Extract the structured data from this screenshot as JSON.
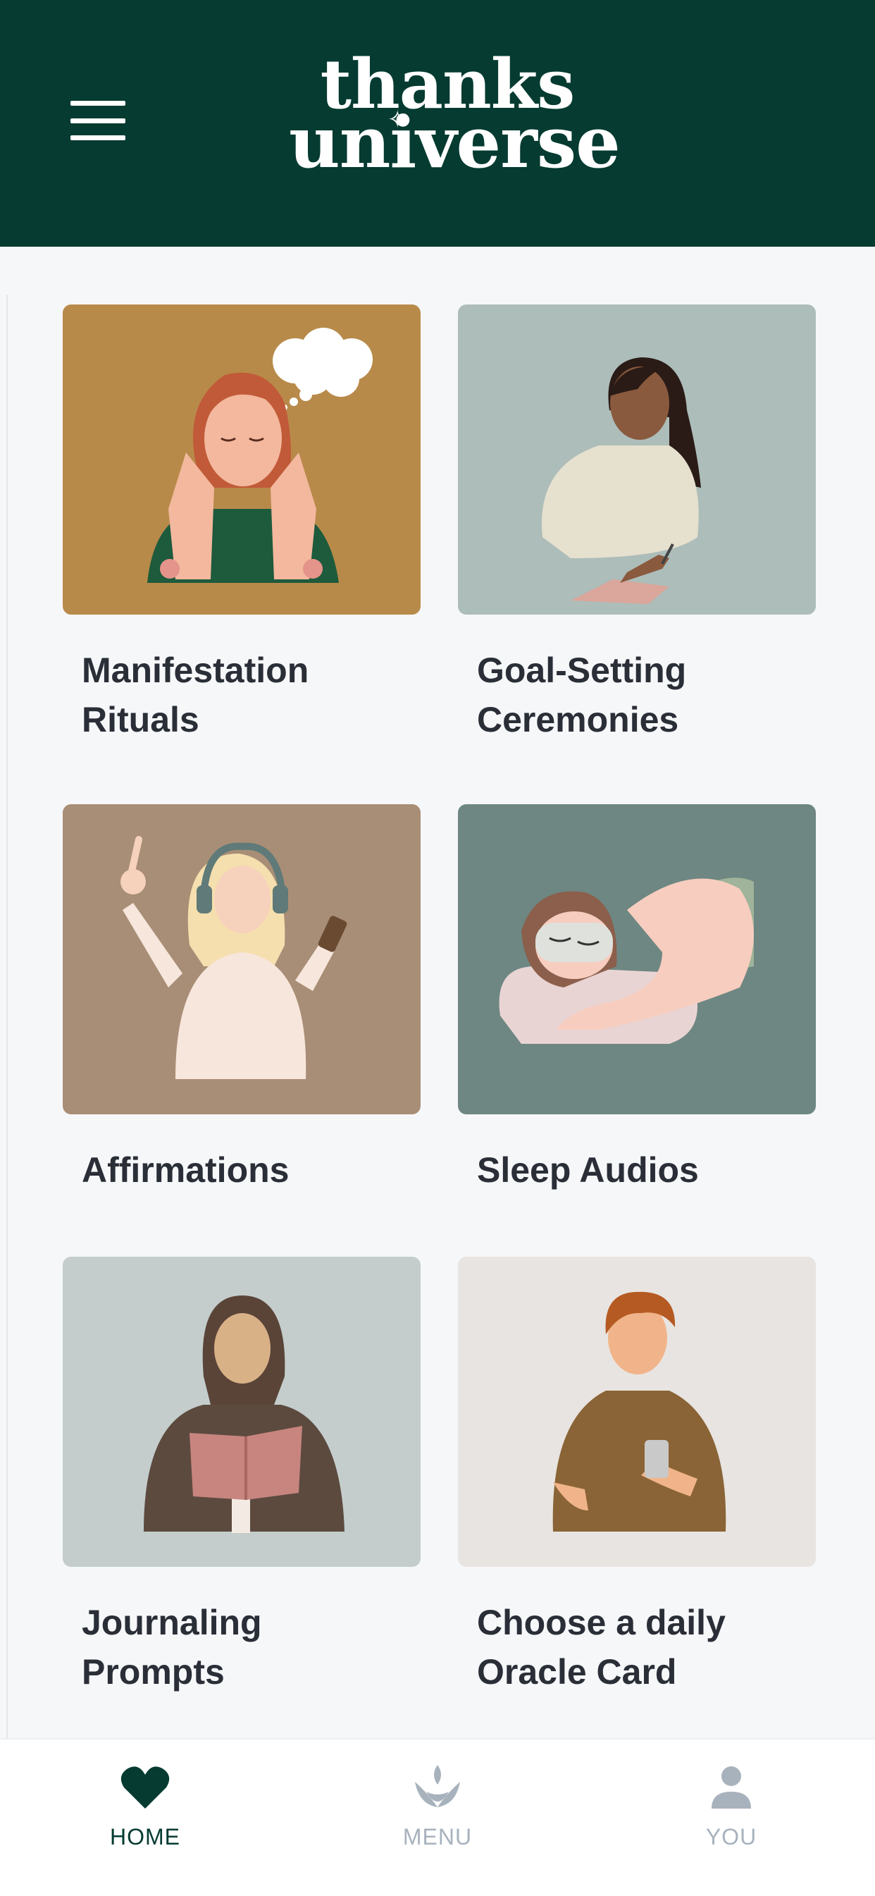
{
  "header": {
    "logo_line1": "thanks",
    "logo_line2": "universe"
  },
  "cards": [
    {
      "label": "Manifestation Rituals",
      "image": "woman-daydreaming-illustration",
      "bg": "#b88a4a"
    },
    {
      "label": "Goal-Setting Ceremonies",
      "image": "woman-writing-in-journal-illustration",
      "bg": "#adbdb9"
    },
    {
      "label": "Affirmations",
      "image": "woman-with-headphones-illustration",
      "bg": "#a88e76"
    },
    {
      "label": "Sleep Audios",
      "image": "woman-sleeping-with-eye-mask-illustration",
      "bg": "#6e8782"
    },
    {
      "label": "Journaling Prompts",
      "image": "woman-reading-book-illustration",
      "bg": "#c4cdcc"
    },
    {
      "label": "Choose a daily Oracle Card",
      "image": "man-looking-at-phone-illustration",
      "bg": "#e8e4e1"
    }
  ],
  "nav": {
    "items": [
      {
        "label": "HOME",
        "icon": "heart-icon",
        "active": true
      },
      {
        "label": "MENU",
        "icon": "lotus-icon",
        "active": false
      },
      {
        "label": "YOU",
        "icon": "user-icon",
        "active": false
      }
    ],
    "active_color": "#053b31",
    "inactive_color": "#a8b2bd"
  }
}
